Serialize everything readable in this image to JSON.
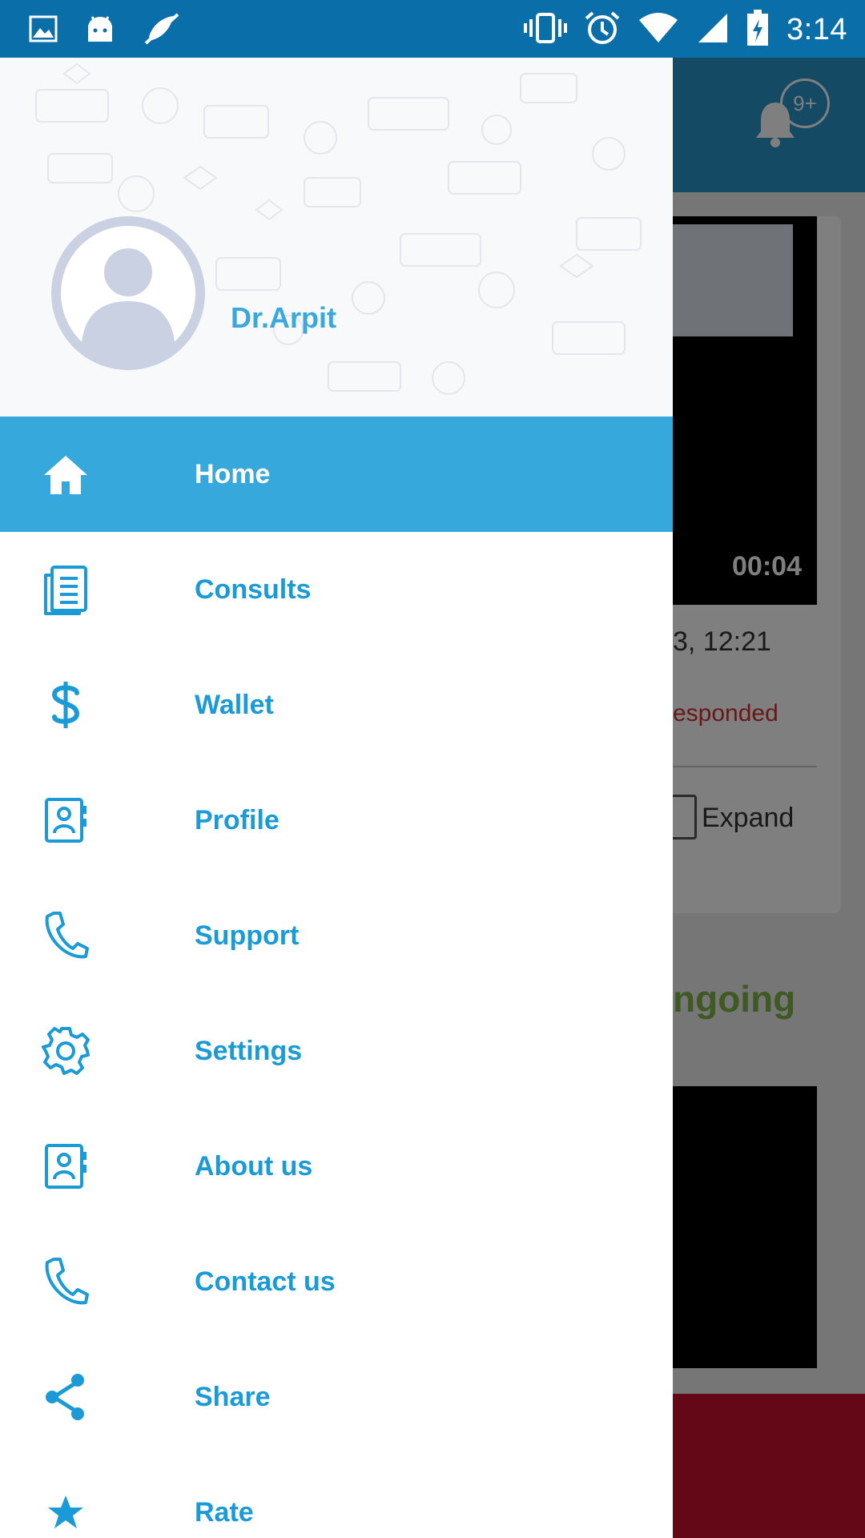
{
  "status_bar": {
    "time": "3:14",
    "left_icons": [
      "image-icon",
      "android-icon",
      "mute-icon"
    ],
    "right_icons": [
      "vibrate-icon",
      "alarm-icon",
      "wifi-icon",
      "signal-icon",
      "battery-charging-icon"
    ]
  },
  "background_app": {
    "notification_badge": "9+",
    "video_duration": "00:04",
    "date_text": "3, 12:21",
    "status_text": "esponded",
    "expand_label": "Expand",
    "section_label": "ngoing"
  },
  "drawer": {
    "username": "Dr.Arpit",
    "items": [
      {
        "label": "Home",
        "icon": "home-icon",
        "active": true
      },
      {
        "label": "Consults",
        "icon": "document-icon",
        "active": false
      },
      {
        "label": "Wallet",
        "icon": "dollar-icon",
        "active": false
      },
      {
        "label": "Profile",
        "icon": "contact-card-icon",
        "active": false
      },
      {
        "label": "Support",
        "icon": "phone-icon",
        "active": false
      },
      {
        "label": "Settings",
        "icon": "gear-icon",
        "active": false
      },
      {
        "label": "About us",
        "icon": "contact-card-icon",
        "active": false
      },
      {
        "label": "Contact us",
        "icon": "phone-icon",
        "active": false
      },
      {
        "label": "Share",
        "icon": "share-icon",
        "active": false
      },
      {
        "label": "Rate",
        "icon": "star-icon",
        "active": false
      }
    ]
  },
  "colors": {
    "status_bar": "#0a6ea8",
    "accent": "#37a8dc",
    "menu_text": "#1a9ad6"
  }
}
